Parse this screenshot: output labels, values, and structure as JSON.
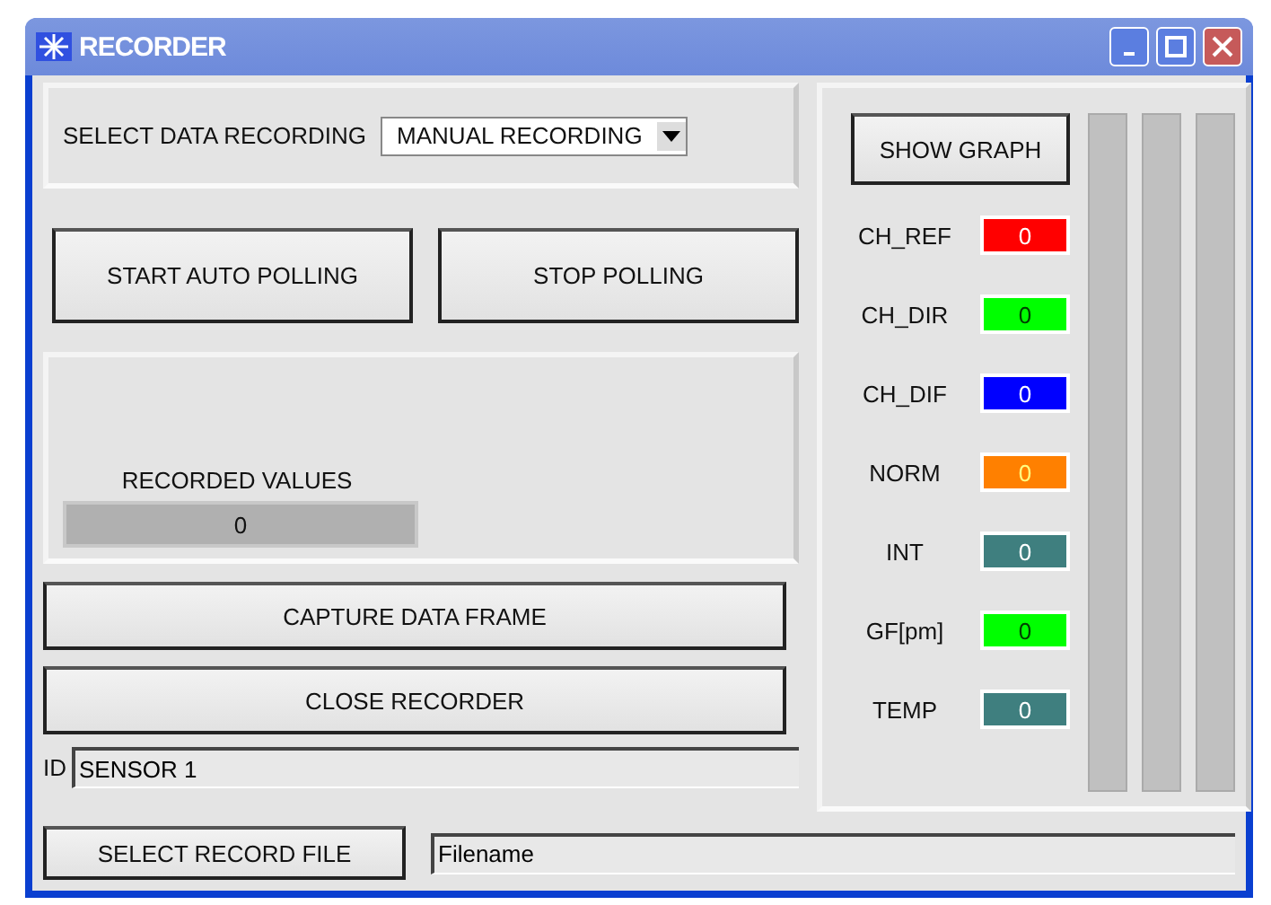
{
  "window": {
    "title": "RECORDER"
  },
  "select_data_recording": {
    "label": "SELECT DATA RECORDING",
    "value": "MANUAL RECORDING"
  },
  "polling_buttons": [
    "START AUTO POLLING",
    "STOP POLLING"
  ],
  "recorded_values": {
    "label": "RECORDED VALUES",
    "value": "0"
  },
  "action_buttons": [
    "CAPTURE DATA FRAME",
    "CLOSE RECORDER"
  ],
  "id_field": {
    "label": "ID",
    "value": "SENSOR 1"
  },
  "record_file": {
    "button": "SELECT RECORD FILE",
    "value": "Filename"
  },
  "show_graph_button": "SHOW GRAPH",
  "channels": [
    {
      "name": "CH_REF",
      "value": "0",
      "color": "#ff0000"
    },
    {
      "name": "CH_DIR",
      "value": "0",
      "color": "#00ff00"
    },
    {
      "name": "CH_DIF",
      "value": "0",
      "color": "#0000ff"
    },
    {
      "name": "NORM",
      "value": "0",
      "color": "#ff8000"
    },
    {
      "name": "INT",
      "value": "0",
      "color": "#3f7f7f"
    },
    {
      "name": "GF[pm]",
      "value": "0",
      "color": "#00ff00"
    },
    {
      "name": "TEMP",
      "value": "0",
      "color": "#3f7f7f"
    }
  ]
}
